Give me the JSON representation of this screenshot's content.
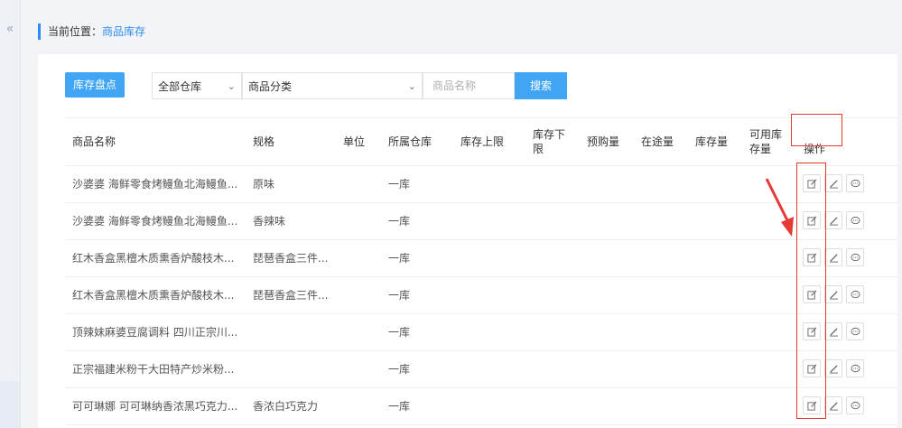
{
  "sidebar": {
    "collapse_icon": "«"
  },
  "breadcrumb": {
    "prefix": "当前位置：",
    "current": "商品库存"
  },
  "toolbar": {
    "stock_check_button": "库存盘点",
    "warehouse_select": "全部仓库",
    "category_select": "商品分类",
    "name_placeholder": "商品名称",
    "search_button": "搜索"
  },
  "table": {
    "headers": [
      "商品名称",
      "规格",
      "单位",
      "所属仓库",
      "库存上限",
      "库存下限",
      "预购量",
      "在途量",
      "库存量",
      "可用库存量",
      "操作"
    ],
    "rows": [
      {
        "name": "沙婆婆 海鲜零食烤鳗鱼北海鳗鱼...",
        "spec": "原味",
        "unit": "",
        "warehouse": "一库"
      },
      {
        "name": "沙婆婆 海鲜零食烤鳗鱼北海鳗鱼...",
        "spec": "香辣味",
        "unit": "",
        "warehouse": "一库"
      },
      {
        "name": "红木香盒黑檀木质熏香炉酸枝木...",
        "spec": "琵琶香盒三件...",
        "unit": "",
        "warehouse": "一库"
      },
      {
        "name": "红木香盒黑檀木质熏香炉酸枝木...",
        "spec": "琵琶香盒三件...",
        "unit": "",
        "warehouse": "一库"
      },
      {
        "name": "顶辣妹麻婆豆腐调料 四川正宗川...",
        "spec": "",
        "unit": "",
        "warehouse": "一库"
      },
      {
        "name": "正宗福建米粉干大田特产炒米粉...",
        "spec": "",
        "unit": "",
        "warehouse": "一库"
      },
      {
        "name": "可可琳娜 可可琳纳香浓黑巧克力...",
        "spec": "香浓白巧克力",
        "unit": "",
        "warehouse": "一库"
      }
    ],
    "row_action_icons": [
      "edit-box-icon",
      "pencil-icon",
      "comment-icon"
    ]
  },
  "annotation": {
    "color": "#e53935"
  }
}
